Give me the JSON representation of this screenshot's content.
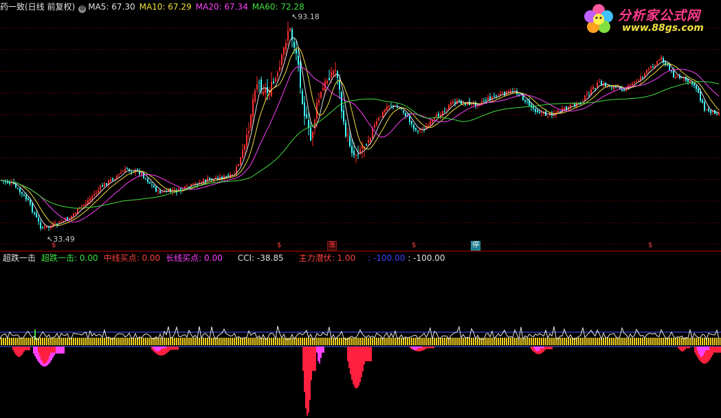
{
  "header": {
    "stock_title": "药一致(日线 前复权)",
    "gear_icon": "gear-icon",
    "ma_items": [
      {
        "label": "MA5: 67.30",
        "color": "#e0e0e0"
      },
      {
        "label": "MA10: 67.29",
        "color": "#f0e040"
      },
      {
        "label": "MA20: 67.34",
        "color": "#ff40ff"
      },
      {
        "label": "MA60: 72.28",
        "color": "#40e040"
      }
    ]
  },
  "price_labels": {
    "high": "93.18",
    "low": "33.49"
  },
  "signals": [
    {
      "text": "$",
      "kind": "s"
    },
    {
      "text": "$",
      "kind": "s"
    },
    {
      "text": "涨",
      "kind": "zhang"
    },
    {
      "text": "$",
      "kind": "s"
    },
    {
      "text": "停",
      "kind": "ting"
    },
    {
      "text": "$",
      "kind": "s"
    }
  ],
  "indicator": {
    "name": "超跌一击",
    "items": [
      {
        "label": "超跌一击: 0.00",
        "color": "#40e040"
      },
      {
        "label": "中线买点: 0.00",
        "color": "#ff4040"
      },
      {
        "label": "长线买点: 0.00",
        "color": "#ff40ff"
      },
      {
        "label": "CCI: -38.85",
        "color": "#e0e0e0"
      },
      {
        "label": "主力潜伏: 1.00",
        "color": "#ff4040"
      },
      {
        "label": ": -100.00",
        "color": "#4040ff"
      },
      {
        "label": ": -100.00",
        "color": "#e0e0e0"
      }
    ]
  },
  "logo": {
    "title": "分析家公式网",
    "url": "www.88gs.com"
  },
  "colors": {
    "up": "#ff3030",
    "down": "#40ffff",
    "ma5": "#e0e0e0",
    "ma10": "#f0e040",
    "ma20": "#ff40ff",
    "ma60": "#40e040",
    "grid": "#6a0000",
    "separator": "#c00000"
  }
}
